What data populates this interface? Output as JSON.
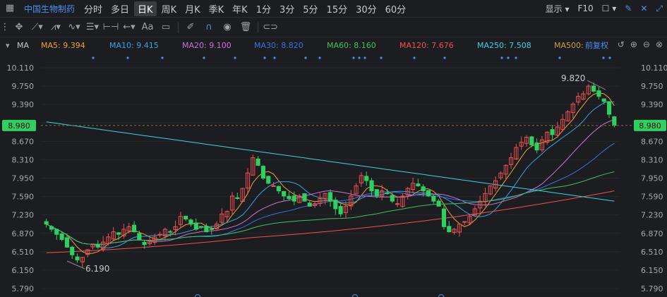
{
  "header": {
    "stock_name": "中国生物制药",
    "periods": [
      "分时",
      "多日",
      "日K",
      "周K",
      "月K",
      "季K",
      "年K",
      "1分",
      "3分",
      "5分",
      "15分",
      "30分",
      "60分"
    ],
    "active_period": "日K",
    "display_label": "显示",
    "f10_label": "F10"
  },
  "toolbar": {
    "text_tool_label": "Aa"
  },
  "ma_bar": {
    "indicator": "MA",
    "items": [
      {
        "label": "MA5: 9.394",
        "color": "#f0a030"
      },
      {
        "label": "MA10: 9.415",
        "color": "#3aa0e0"
      },
      {
        "label": "MA20: 9.100",
        "color": "#d070d0"
      },
      {
        "label": "MA30: 8.820",
        "color": "#3a70e0"
      },
      {
        "label": "MA60: 8.160",
        "color": "#40c060"
      },
      {
        "label": "MA120: 7.676",
        "color": "#f05050"
      },
      {
        "label": "MA250: 7.508",
        "color": "#40d0e0"
      },
      {
        "label": "MA500:",
        "color": "#c8a040"
      }
    ],
    "adjust_label": "前复权"
  },
  "chart_data": {
    "type": "candlestick",
    "y_ticks": [
      "10.110",
      "9.750",
      "9.390",
      "9.030",
      "8.670",
      "8.310",
      "7.950",
      "7.590",
      "7.230",
      "6.870",
      "6.510",
      "6.150",
      "5.790"
    ],
    "y_tick_values": [
      10.11,
      9.75,
      9.39,
      9.03,
      8.67,
      8.31,
      7.95,
      7.59,
      7.23,
      6.87,
      6.51,
      6.15,
      5.79
    ],
    "ylim": [
      5.79,
      10.11
    ],
    "current_price": "8.980",
    "current_price_value": 8.98,
    "high_annotation": "9.820",
    "high_value": 9.82,
    "low_annotation": "6.190",
    "low_value": 6.19,
    "colors": {
      "up": "#f05050",
      "down": "#2fd060",
      "price_tag": "#2fd060"
    },
    "closes": [
      7.05,
      6.95,
      6.85,
      6.75,
      6.6,
      6.45,
      6.35,
      6.4,
      6.55,
      6.65,
      6.6,
      6.7,
      6.8,
      6.9,
      6.85,
      6.95,
      7.0,
      6.9,
      6.75,
      6.65,
      6.7,
      6.8,
      6.85,
      6.95,
      6.9,
      7.0,
      7.2,
      7.15,
      7.05,
      6.95,
      7.0,
      6.9,
      6.95,
      7.05,
      7.25,
      7.3,
      7.6,
      7.55,
      7.75,
      8.05,
      8.35,
      8.2,
      7.95,
      7.85,
      7.8,
      7.7,
      7.6,
      7.55,
      7.5,
      7.6,
      7.5,
      7.4,
      7.45,
      7.55,
      7.65,
      7.5,
      7.35,
      7.25,
      7.4,
      7.6,
      7.8,
      8.0,
      7.9,
      7.7,
      7.6,
      7.7,
      7.65,
      7.5,
      7.45,
      7.6,
      7.75,
      7.85,
      7.8,
      7.7,
      7.6,
      7.5,
      7.4,
      7.0,
      6.9,
      6.95,
      7.05,
      7.1,
      7.2,
      7.35,
      7.5,
      7.65,
      7.8,
      7.9,
      8.05,
      8.2,
      8.35,
      8.55,
      8.65,
      8.75,
      8.6,
      8.5,
      8.7,
      8.85,
      8.8,
      8.95,
      9.1,
      9.25,
      9.4,
      9.55,
      9.6,
      9.75,
      9.65,
      9.55,
      9.45,
      9.2,
      8.98
    ],
    "ma_series": [
      {
        "name": "MA5",
        "color": "#f0a030"
      },
      {
        "name": "MA10",
        "color": "#3aa0e0"
      },
      {
        "name": "MA20",
        "color": "#d070d0"
      },
      {
        "name": "MA30",
        "color": "#3a70e0"
      },
      {
        "name": "MA60",
        "color": "#40c060"
      },
      {
        "name": "MA120",
        "color": "#f05050"
      },
      {
        "name": "MA250",
        "color": "#40d0e0"
      }
    ]
  }
}
